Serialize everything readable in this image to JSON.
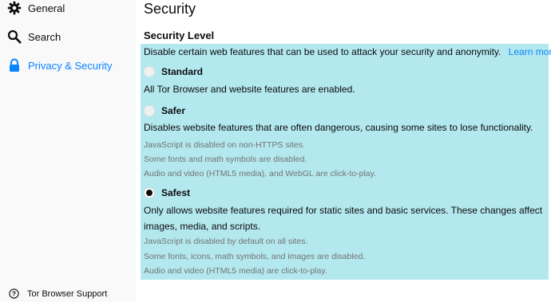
{
  "sidebar": {
    "items": [
      {
        "label": "General",
        "icon": "gear-icon"
      },
      {
        "label": "Search",
        "icon": "search-icon"
      },
      {
        "label": "Privacy & Security",
        "icon": "lock-icon",
        "selected": true
      }
    ],
    "support_label": "Tor Browser Support"
  },
  "main": {
    "title": "Security",
    "section_title": "Security Level",
    "intro": "Disable certain web features that can be used to attack your security and anonymity.",
    "learn_more": "Learn more",
    "options": [
      {
        "name": "Standard",
        "selected": false,
        "description": "All Tor Browser and website features are enabled.",
        "notes": []
      },
      {
        "name": "Safer",
        "selected": false,
        "description": "Disables website features that are often dangerous, causing some sites to lose functionality.",
        "notes": [
          "JavaScript is disabled on non-HTTPS sites.",
          "Some fonts and math symbols are disabled.",
          "Audio and video (HTML5 media), and WebGL are click-to-play."
        ]
      },
      {
        "name": "Safest",
        "selected": true,
        "description_line1": "Only allows website features required for static sites and basic services. These changes affect",
        "description_line2": "images, media, and scripts.",
        "notes": [
          "JavaScript is disabled by default on all sites.",
          "Some fonts, icons, math symbols, and images are disabled.",
          "Audio and video (HTML5 media) are click-to-play."
        ]
      }
    ]
  },
  "colors": {
    "accent": "#0a84ff",
    "panel_highlight": "#b3e8ef",
    "note_text": "#737373"
  }
}
